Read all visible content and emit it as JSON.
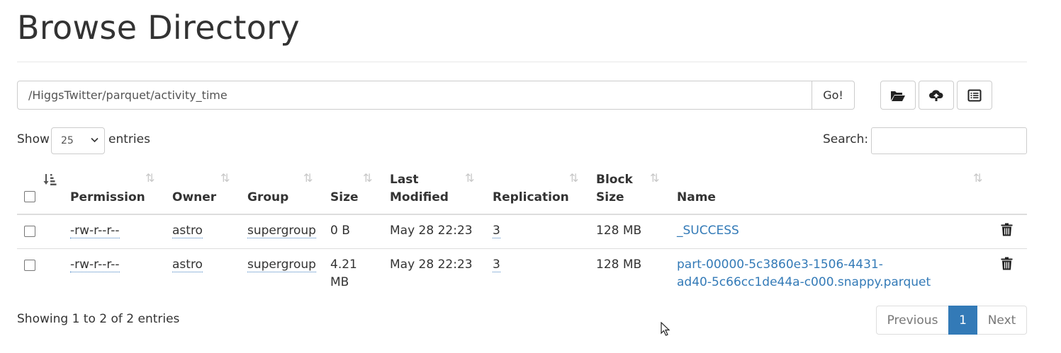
{
  "page": {
    "title": "Browse Directory"
  },
  "path_bar": {
    "value": "/HiggsTwitter/parquet/activity_time",
    "go_label": "Go!"
  },
  "toolbar": {
    "icons": [
      "folder-open-icon",
      "cloud-upload-icon",
      "list-alt-icon"
    ]
  },
  "length": {
    "show_label": "Show",
    "value": "25",
    "entries_label": "entries"
  },
  "search": {
    "label": "Search:",
    "value": ""
  },
  "table": {
    "columns": {
      "permission": "Permission",
      "owner": "Owner",
      "group": "Group",
      "size": "Size",
      "last_modified_1": "Last",
      "last_modified_2": "Modified",
      "replication": "Replication",
      "block_size_1": "Block",
      "block_size_2": "Size",
      "name": "Name"
    },
    "rows": [
      {
        "permission": "-rw-r--r--",
        "owner": "astro",
        "group": "supergroup",
        "size_1": "0 B",
        "size_2": "",
        "last_modified": "May 28 22:23",
        "replication": "3",
        "block_size": "128 MB",
        "name_1": "_SUCCESS",
        "name_2": ""
      },
      {
        "permission": "-rw-r--r--",
        "owner": "astro",
        "group": "supergroup",
        "size_1": "4.21",
        "size_2": "MB",
        "last_modified": "May 28 22:23",
        "replication": "3",
        "block_size": "128 MB",
        "name_1": "part-00000-5c3860e3-1506-4431-",
        "name_2": "ad40-5c66cc1de44a-c000.snappy.parquet"
      }
    ]
  },
  "footer": {
    "info": "Showing 1 to 2 of 2 entries"
  },
  "pagination": {
    "previous": "Previous",
    "current": "1",
    "next": "Next"
  },
  "colors": {
    "link": "#337ab7",
    "active_page": "#337ab7",
    "text": "#333333",
    "border": "#cccccc"
  }
}
